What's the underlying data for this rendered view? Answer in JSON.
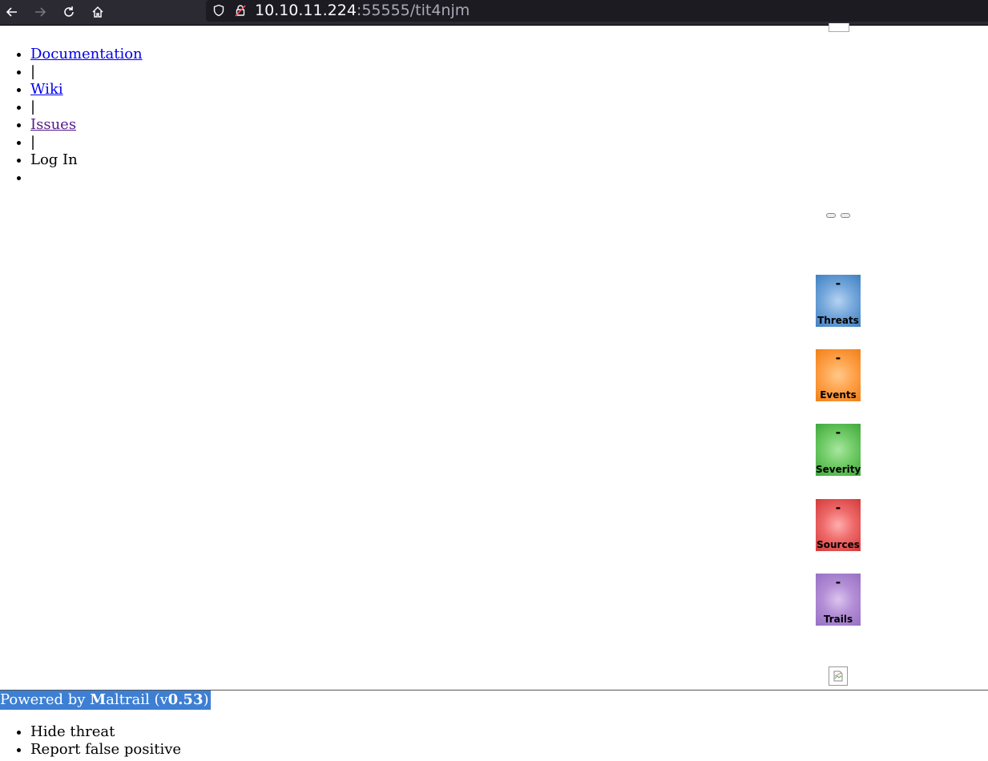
{
  "browser": {
    "url_host": "10.10.11.224",
    "url_rest": ":55555/tit4njm",
    "icons": [
      "back-arrow-icon",
      "forward-arrow-icon",
      "reload-icon",
      "home-icon",
      "shield-icon",
      "insecure-lock-icon"
    ]
  },
  "nav": {
    "documentation": "Documentation",
    "sep1": "|",
    "wiki": "Wiki",
    "sep2": "|",
    "issues": "Issues",
    "sep3": "|",
    "login": "Log In",
    "empty": ""
  },
  "tiles": [
    {
      "value": "-",
      "label": "Threats",
      "color": "#76a8dc"
    },
    {
      "value": "-",
      "label": "Events",
      "color": "#ffa34c"
    },
    {
      "value": "-",
      "label": "Severity",
      "color": "#72cc68"
    },
    {
      "value": "-",
      "label": "Sources",
      "color": "#ef6a6a"
    },
    {
      "value": "-",
      "label": "Trails",
      "color": "#b48fd6"
    }
  ],
  "footer": {
    "powered_prefix": "Powered by ",
    "brand_initial": "M",
    "brand_rest": "altrail",
    "version_open": " (v",
    "version": "0.53",
    "version_close": ")"
  },
  "context_menu": {
    "hide_threat": "Hide threat",
    "report_false_positive": "Report false positive"
  }
}
